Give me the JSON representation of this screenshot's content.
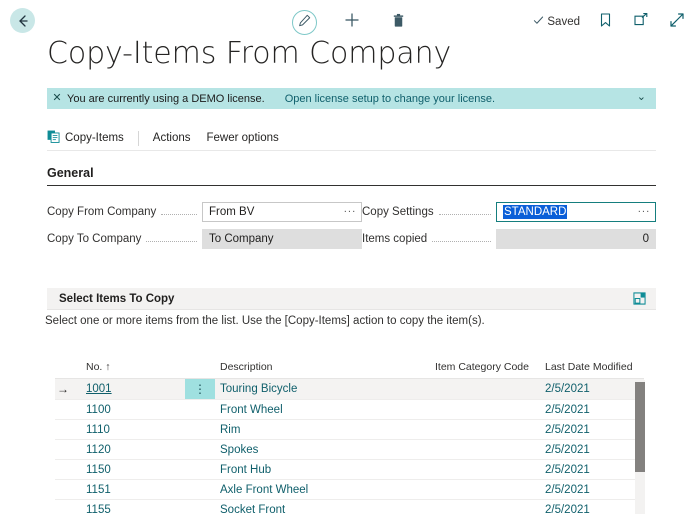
{
  "topbar": {
    "back_icon": "arrow-left-icon",
    "edit_icon": "pencil-icon",
    "new_icon": "plus-icon",
    "delete_icon": "trash-icon",
    "saved_label": "Saved",
    "saved_check_icon": "check-icon",
    "bookmark_icon": "bookmark-icon",
    "open-new-window_icon": "open-in-new-window-icon",
    "expand_icon": "expand-diagonal-icon"
  },
  "page": {
    "title": "Copy-Items From Company"
  },
  "notification": {
    "close_label": "✕",
    "message": "You are currently using a DEMO license.",
    "link": "Open license setup to change your license.",
    "chevron": "⌄",
    "background": "#b6e4e4"
  },
  "actionbar": {
    "copy_items_label": "Copy-Items",
    "copy_items_icon": "copy-pages-icon",
    "actions_label": "Actions",
    "fewer_options_label": "Fewer options"
  },
  "general": {
    "heading": "General",
    "fields": [
      {
        "label": "Copy From Company",
        "value": "From BV",
        "state": "editable",
        "assist": "···"
      },
      {
        "label": "Copy Settings",
        "value": "STANDARD",
        "state": "focused-selected",
        "assist": "···"
      },
      {
        "label": "Copy To Company",
        "value": "To Company",
        "state": "readonly",
        "assist": ""
      },
      {
        "label": "Items copied",
        "value": "0",
        "state": "readonly-numeric",
        "assist": ""
      }
    ]
  },
  "select_items": {
    "card_title": "Select Items To Copy",
    "expand_icon": "expand-card-icon",
    "subtitle": "Select one or more items from the list. Use the [Copy-Items] action to copy the item(s).",
    "columns": [
      "No. ↑",
      "Description",
      "Item Category Code",
      "Last Date Modified"
    ],
    "rows": [
      {
        "indicator": "→",
        "no": "1001",
        "menu": "⋮",
        "description": "Touring Bicycle",
        "category": "",
        "date": "2/5/2021",
        "selected": true
      },
      {
        "indicator": "",
        "no": "1100",
        "menu": "",
        "description": "Front Wheel",
        "category": "",
        "date": "2/5/2021",
        "selected": false
      },
      {
        "indicator": "",
        "no": "1110",
        "menu": "",
        "description": "Rim",
        "category": "",
        "date": "2/5/2021",
        "selected": false
      },
      {
        "indicator": "",
        "no": "1120",
        "menu": "",
        "description": "Spokes",
        "category": "",
        "date": "2/5/2021",
        "selected": false
      },
      {
        "indicator": "",
        "no": "1150",
        "menu": "",
        "description": "Front Hub",
        "category": "",
        "date": "2/5/2021",
        "selected": false
      },
      {
        "indicator": "",
        "no": "1151",
        "menu": "",
        "description": "Axle Front Wheel",
        "category": "",
        "date": "2/5/2021",
        "selected": false
      },
      {
        "indicator": "",
        "no": "1155",
        "menu": "",
        "description": "Socket Front",
        "category": "",
        "date": "2/5/2021",
        "selected": false
      }
    ]
  },
  "colors": {
    "accent_teal": "#0f5f6b",
    "notification_bg": "#b6e4e4",
    "selection_blue": "#0b5fd8",
    "row_menu_teal": "#9fe0e0"
  }
}
